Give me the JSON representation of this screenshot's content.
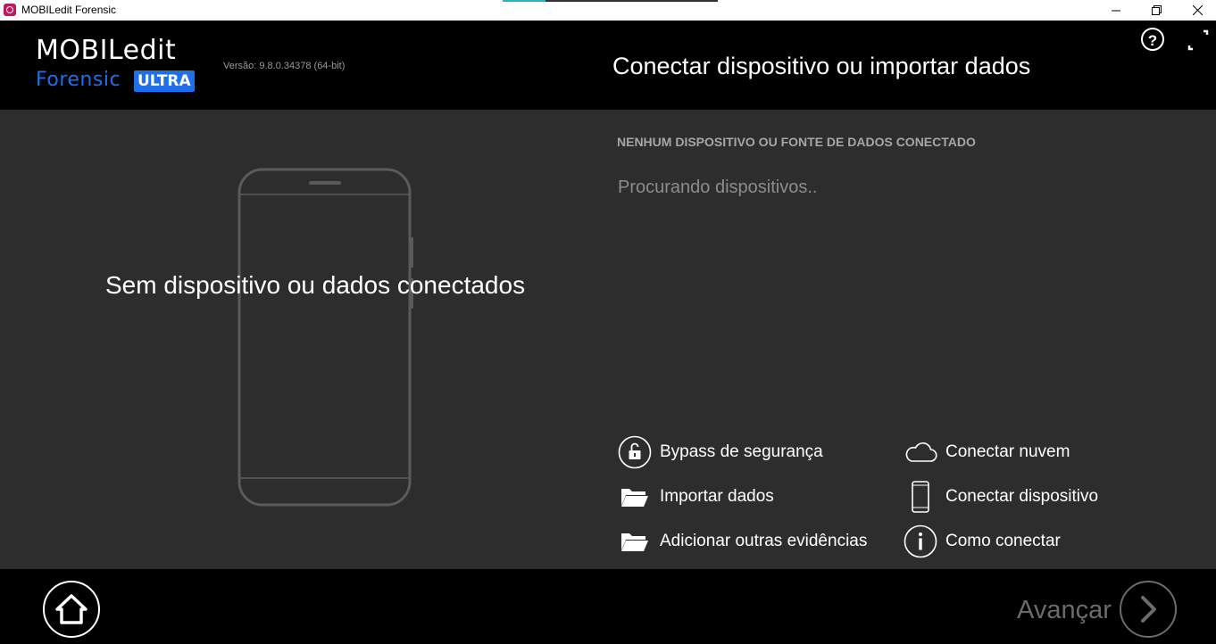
{
  "window": {
    "title": "MOBILedit Forensic",
    "icons": [
      "app-icon",
      "minimize-icon",
      "restore-icon",
      "close-icon"
    ]
  },
  "header": {
    "logo_main": "MOBILedit",
    "logo_sub": "Forensic",
    "logo_badge": "ULTRA",
    "version": "Versão: 9.8.0.34378 (64-bit)",
    "heading": "Conectar dispositivo ou importar dados",
    "help_label": "?"
  },
  "left_panel": {
    "message": "Sem dispositivo ou dados conectados"
  },
  "right_panel": {
    "status_title": "NENHUM DISPOSITIVO OU FONTE DE DADOS CONECTADO",
    "status_text": "Procurando dispositivos.."
  },
  "actions": {
    "bypass": "Bypass de segurança",
    "import": "Importar dados",
    "add_evidence": "Adicionar outras evidências",
    "cloud": "Conectar nuvem",
    "device": "Conectar dispositivo",
    "how": "Como conectar"
  },
  "footer": {
    "next_label": "Avançar"
  },
  "colors": {
    "header_bg": "#000000",
    "main_bg": "#2d2d2d",
    "brand_blue": "#1f6fe8",
    "disabled_gray": "#6b6b6b"
  }
}
